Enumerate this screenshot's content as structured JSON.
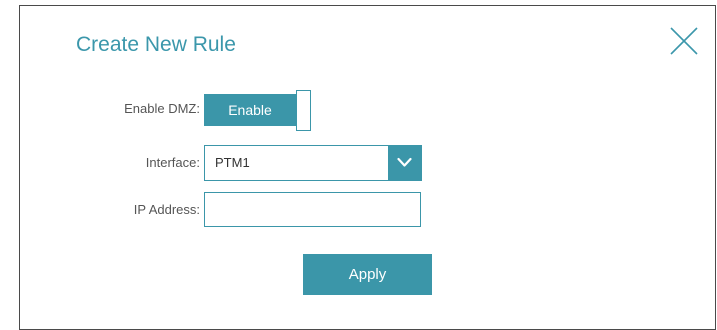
{
  "dialog": {
    "title": "Create New Rule",
    "close_icon": "close-icon"
  },
  "form": {
    "enable_dmz": {
      "label": "Enable DMZ:",
      "toggle_label": "Enable",
      "state": "on"
    },
    "interface": {
      "label": "Interface:",
      "selected": "PTM1",
      "arrow_icon": "chevron-down-icon"
    },
    "ip_address": {
      "label": "IP Address:",
      "value": ""
    },
    "apply_label": "Apply"
  },
  "colors": {
    "accent": "#3b96a9",
    "title": "#3b97ab",
    "label": "#555555",
    "border": "#4a4a4a"
  }
}
